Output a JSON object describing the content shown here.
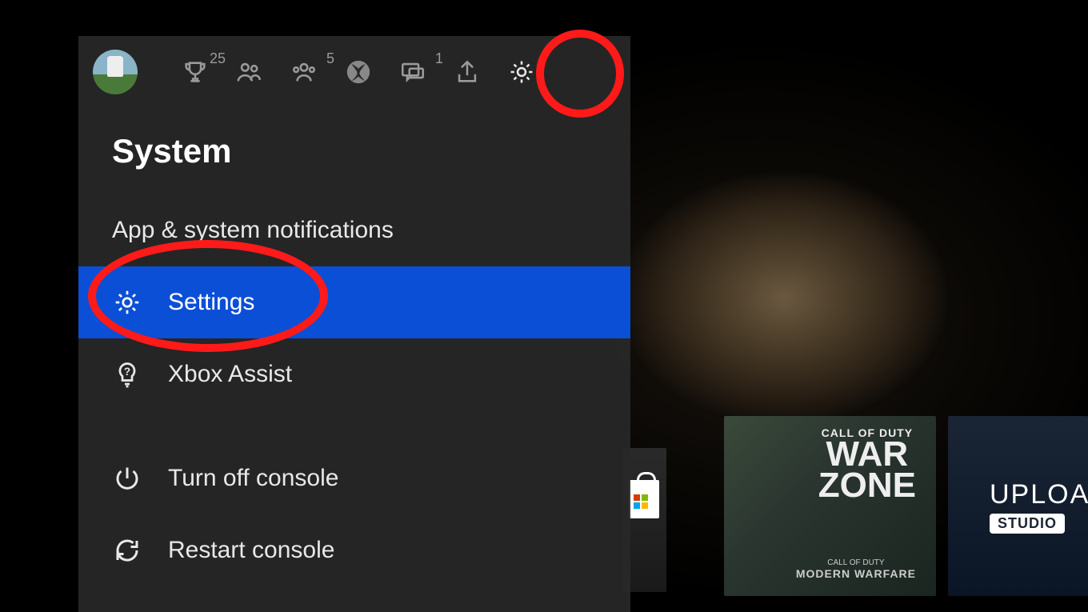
{
  "guide": {
    "header": {
      "achievements_badge": "25",
      "party_badge": "5",
      "messages_badge": "1"
    },
    "section_title": "System",
    "items": {
      "notifications": "App & system notifications",
      "settings": "Settings",
      "assist": "Xbox Assist",
      "turnoff": "Turn off console",
      "restart": "Restart console"
    }
  },
  "background_tiles": {
    "warzone": {
      "franchise": "CALL OF DUTY",
      "line1": "WAR",
      "line2": "ZONE",
      "sub1": "CALL OF DUTY",
      "sub2": "MODERN WARFARE"
    },
    "upload": {
      "line1": "UPLOAD",
      "line2": "STUDIO"
    }
  }
}
